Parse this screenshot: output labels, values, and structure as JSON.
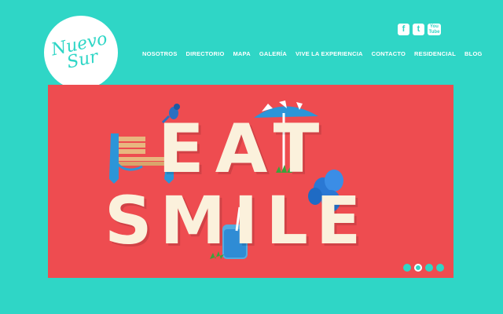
{
  "logo": {
    "line1": "Nuevo",
    "line2": "Sur"
  },
  "social": {
    "facebook": "f",
    "twitter": "t",
    "youtube_top": "You",
    "youtube_bottom": "Tube"
  },
  "nav": {
    "items": [
      "NOSOTROS",
      "DIRECTORIO",
      "MAPA",
      "GALERÍA",
      "VIVE LA EXPERIENCIA",
      "CONTACTO",
      "RESIDENCIAL",
      "BLOG"
    ]
  },
  "hero": {
    "line1": "EAT",
    "line2": "SMILE"
  },
  "slider": {
    "count": 4,
    "active": 1
  },
  "colors": {
    "background": "#2fd6c6",
    "hero": "#ee4c50",
    "hero_text": "#fbf1dc"
  }
}
